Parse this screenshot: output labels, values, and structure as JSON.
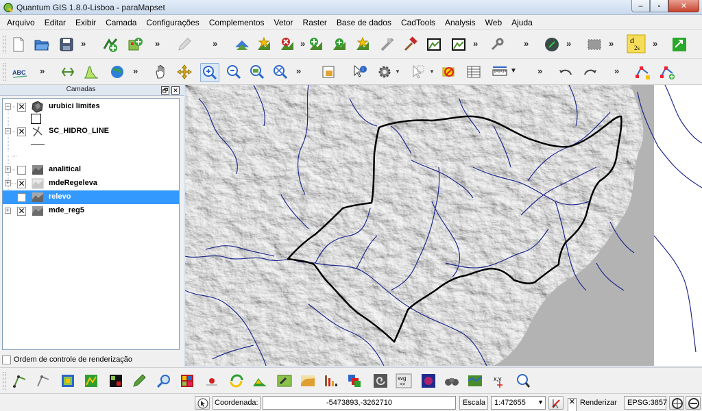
{
  "window": {
    "title": "Quantum GIS 1.8.0-Lisboa - paraMapset",
    "minimize": "–",
    "maximize": "▫",
    "close": "✕"
  },
  "menu": [
    "Arquivo",
    "Editar",
    "Exibir",
    "Camada",
    "Configurações",
    "Complementos",
    "Vetor",
    "Raster",
    "Base de dados",
    "CadTools",
    "Analysis",
    "Web",
    "Ajuda"
  ],
  "toolbar_overflow": "»",
  "toolbar_icons": {
    "label_text": "ABC",
    "d2s_main": "d",
    "d2s_sub": "2s",
    "svg_label": "svg",
    "svg_arrows": "<>",
    "xy_label": "x,y"
  },
  "layers_panel": {
    "title": "Camadas",
    "float_button": "🗗",
    "close_button": "✕",
    "layers": [
      {
        "name": "urubici limites",
        "expander": "−",
        "checked": "✕",
        "icon": "polygon-layer-icon"
      },
      {
        "name": "SC_HIDRO_LINE",
        "expander": "−",
        "checked": "✕",
        "icon": "line-layer-icon"
      },
      {
        "name": "analitical",
        "expander": "+",
        "checked": "",
        "icon": "raster-layer-icon"
      },
      {
        "name": "mdeRegeleva",
        "expander": "+",
        "checked": "✕",
        "icon": "raster-layer-icon"
      },
      {
        "name": "relevo",
        "expander": "",
        "checked": "",
        "icon": "raster-layer-icon",
        "selected": true
      },
      {
        "name": "mde_reg5",
        "expander": "+",
        "checked": "✕",
        "icon": "raster-layer-icon"
      }
    ],
    "render_order_label": "Ordem de controle de renderização"
  },
  "statusbar": {
    "coord_label": "Coordenada:",
    "coord_value": "-5473893,-3262710",
    "scale_label": "Escala",
    "scale_value": "1:472655",
    "render_label": "Renderizar",
    "render_checked": "✕",
    "epsg": "EPSG:3857"
  },
  "colors": {
    "river": "#1f2a8c",
    "boundary": "#000000",
    "selection": "#3399ff",
    "nodata": "#b3b3b3"
  }
}
